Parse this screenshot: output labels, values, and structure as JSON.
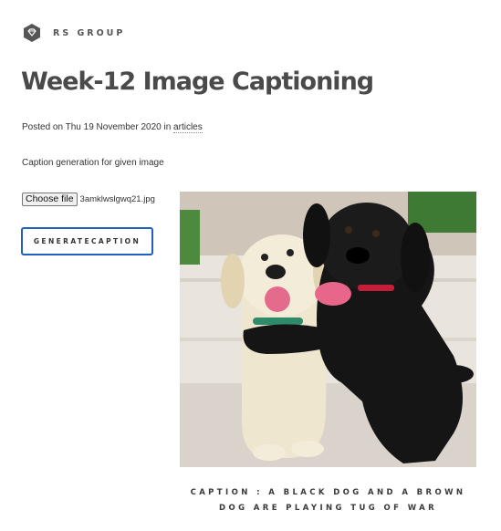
{
  "header": {
    "brand_name": "RS GROUP",
    "logo_icon": "diamond-hexagon-icon"
  },
  "post": {
    "title": "Week-12 Image Captioning",
    "posted_prefix": "Posted on Thu 19 November 2020 in ",
    "category_link": "articles",
    "description": "Caption generation for given image"
  },
  "upload": {
    "choose_file_label": "Choose file",
    "file_name": "3amklwslgwq21.jpg"
  },
  "actions": {
    "generate_label": "GENERATECAPTION"
  },
  "result": {
    "image_subject": "black-and-yellow-puppies-photo",
    "caption": "CAPTION : A BLACK DOG AND A BROWN DOG ARE PLAYING TUG OF WAR"
  },
  "colors": {
    "title": "#4a4a4a",
    "button_border": "#1f5fbf",
    "logo_bg": "#555555"
  }
}
